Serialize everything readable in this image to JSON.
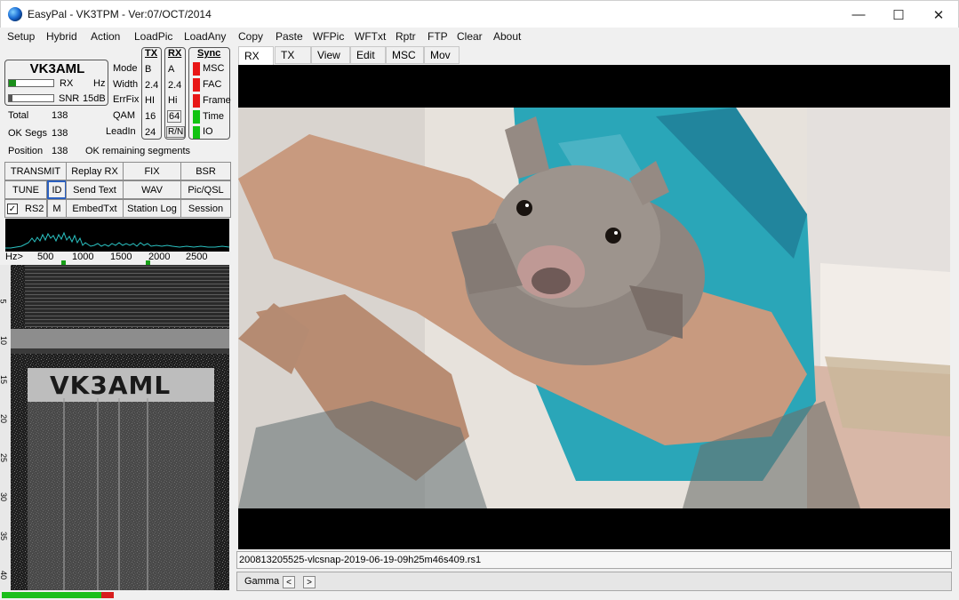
{
  "window": {
    "title": "EasyPal - VK3TPM - Ver:07/OCT/2014",
    "app_icon": "globe-icon",
    "controls": {
      "minimize": "—",
      "maximize": "☐",
      "close": "✕"
    }
  },
  "menu": [
    "Setup",
    "Hybrid",
    "Action",
    "LoadPic",
    "LoadAny",
    "Copy",
    "Paste",
    "WFPic",
    "WFTxt",
    "Rptr",
    "FTP",
    "Clear",
    "About"
  ],
  "receiver": {
    "callsign": "VK3AML",
    "rx_label": "RX",
    "hz_label": "Hz",
    "snr_label": "SNR",
    "snr_value": "15dB",
    "total_label": "Total",
    "total_value": "138",
    "ok_segs_label": "OK Segs",
    "ok_segs_value": "138",
    "position_label": "Position",
    "position_value": "138",
    "remaining_text": "OK remaining segments"
  },
  "params": {
    "labels": [
      "Mode",
      "Width",
      "ErrFix",
      "QAM",
      "LeadIn"
    ],
    "tx_header": "TX",
    "tx_values": [
      "B",
      "2.4",
      "HI",
      "16",
      "24"
    ],
    "rx_header": "RX",
    "rx_values": [
      "A",
      "2.4",
      "Hi",
      "64"
    ],
    "rn_button": "R/N"
  },
  "sync": {
    "header": "Sync",
    "items": [
      {
        "label": "MSC",
        "color": "#e81616"
      },
      {
        "label": "FAC",
        "color": "#e81616"
      },
      {
        "label": "Frame",
        "color": "#e81616"
      },
      {
        "label": "Time",
        "color": "#12c312"
      },
      {
        "label": "IO",
        "color": "#12c312"
      }
    ]
  },
  "buttons": {
    "row1": [
      "TRANSMIT",
      "Replay RX",
      "FIX",
      "BSR"
    ],
    "row2": [
      "TUNE",
      "ID",
      "Send Text",
      "WAV",
      "Pic/QSL"
    ],
    "row3": [
      "RS2",
      "M",
      "EmbedTxt",
      "Station Log",
      "Session"
    ],
    "rs2_checked": true
  },
  "spectrum": {
    "ruler_prefix": "Hz>",
    "ticks": [
      "500",
      "1000",
      "1500",
      "2000",
      "2500"
    ]
  },
  "waterfall": {
    "overlay_text": "VK3AML",
    "axis_labels": [
      "5",
      "10",
      "15",
      "20",
      "25",
      "30",
      "35",
      "40"
    ]
  },
  "tabs": [
    "RX",
    "TX",
    "View",
    "Edit",
    "MSC",
    "Mov"
  ],
  "active_tab": "RX",
  "image_view": {
    "filename": "200813205525-vlcsnap-2019-06-19-09h25m46s409.rs1",
    "gamma_label": "Gamma",
    "gamma_prev": "<",
    "gamma_next": ">"
  },
  "progress": {
    "good_fraction": 0.9,
    "good_color": "#1bbf1b",
    "bad_color": "#d81d1d"
  }
}
